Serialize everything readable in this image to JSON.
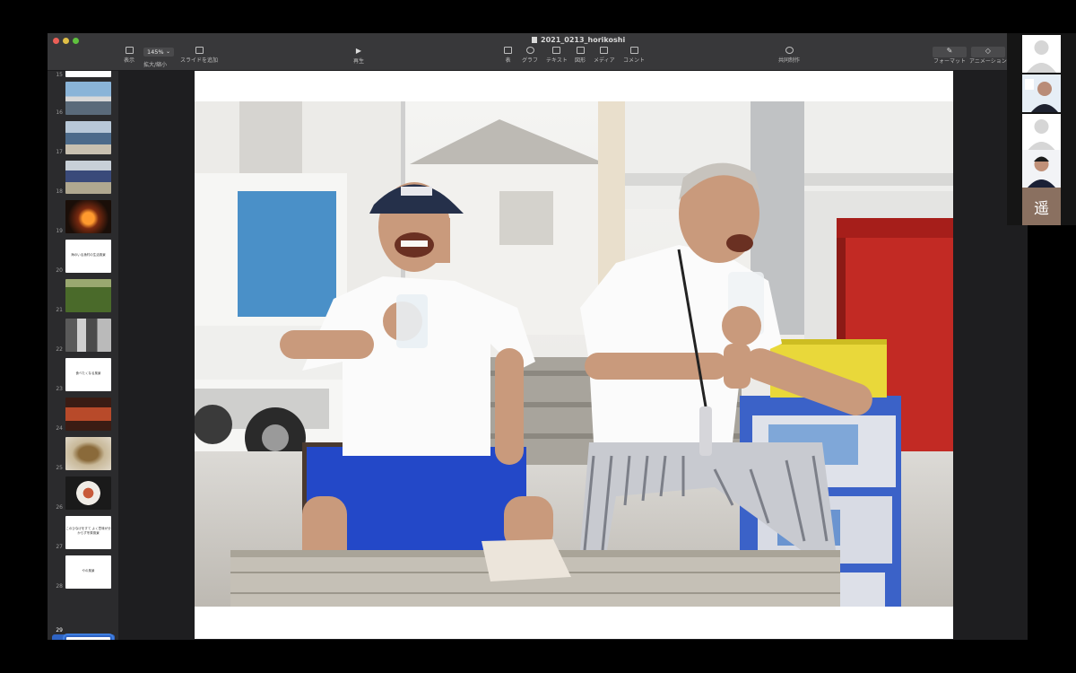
{
  "app": {
    "document_title": "2021_0213_horikoshi",
    "zoom": "145%"
  },
  "toolbar": {
    "left": [
      {
        "label": "表示",
        "icon": "sidebar-icon"
      },
      {
        "label": "拡大/縮小",
        "icon": "zoom-icon"
      },
      {
        "label": "スライドを追加",
        "icon": "add-slide-icon"
      }
    ],
    "center": [
      {
        "label": "再生",
        "icon": "play-icon"
      }
    ],
    "insert": [
      {
        "label": "表",
        "icon": "table-icon"
      },
      {
        "label": "グラフ",
        "icon": "chart-icon"
      },
      {
        "label": "テキスト",
        "icon": "text-icon"
      },
      {
        "label": "図形",
        "icon": "shape-icon"
      },
      {
        "label": "メディア",
        "icon": "media-icon"
      },
      {
        "label": "コメント",
        "icon": "comment-icon"
      }
    ],
    "collab": {
      "label": "共同制作",
      "icon": "collaborate-icon"
    },
    "right": [
      {
        "label": "フォーマット",
        "icon": "format-icon"
      },
      {
        "label": "アニメーション",
        "icon": "animate-icon"
      }
    ]
  },
  "slides": [
    {
      "num": "15",
      "kind": "blank"
    },
    {
      "num": "16",
      "kind": "photo1"
    },
    {
      "num": "17",
      "kind": "photo2"
    },
    {
      "num": "18",
      "kind": "photo3"
    },
    {
      "num": "19",
      "kind": "fire"
    },
    {
      "num": "20",
      "kind": "text",
      "text": "海のいる漁村の生活風景"
    },
    {
      "num": "21",
      "kind": "grass"
    },
    {
      "num": "22",
      "kind": "street"
    },
    {
      "num": "23",
      "kind": "text",
      "text": "食べたくなる風景"
    },
    {
      "num": "24",
      "kind": "crab"
    },
    {
      "num": "25",
      "kind": "bowl"
    },
    {
      "num": "26",
      "kind": "plate"
    },
    {
      "num": "27",
      "kind": "text",
      "text": "このひなげをすて よく意味が分からず冬祭風景"
    },
    {
      "num": "28",
      "kind": "text",
      "text": "やの風景"
    },
    {
      "num": "29",
      "kind": "selected"
    }
  ],
  "participants": [
    {
      "kind": "placeholder"
    },
    {
      "kind": "video"
    },
    {
      "kind": "placeholder"
    },
    {
      "kind": "video"
    },
    {
      "kind": "initial",
      "initial": "遥"
    }
  ],
  "colors": {
    "selection": "#2f64c4",
    "toolbar_bg": "#38383a",
    "sidebar_bg": "#2b2b2d"
  }
}
